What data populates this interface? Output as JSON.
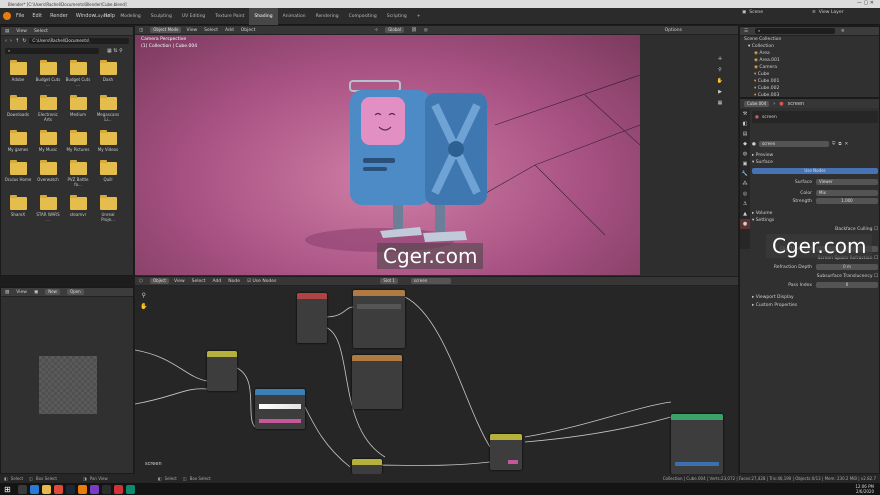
{
  "titlebar": {
    "title": "Blender* [C:\\Users\\Rachel\\Documents\\Blender\\Cube.blend]"
  },
  "menu": [
    "File",
    "Edit",
    "Render",
    "Window",
    "Help"
  ],
  "workspaces": [
    "Layout",
    "Modeling",
    "Sculpting",
    "UV Editing",
    "Texture Paint",
    "Shading",
    "Animation",
    "Rendering",
    "Compositing",
    "Scripting"
  ],
  "active_workspace": "Shading",
  "scene": {
    "label": "Scene",
    "view_layer": "View Layer"
  },
  "file_browser": {
    "header": [
      "View",
      "Select"
    ],
    "path": "C:\\Users\\Rachel\\Documents\\",
    "folders": [
      "Adobe",
      "Budget Cuts ...",
      "Budget Cuts ...",
      "Dash",
      "Downloads",
      "Electronic Arts",
      "Medium",
      "Megascans Li...",
      "My games",
      "My Music",
      "My Pictures",
      "My Videos",
      "Oculus Home",
      "Overwatch",
      "PVZ Battle fo...",
      "Quill",
      "ShareX",
      "STAR WARS ...",
      "steamvr",
      "Unreal Proje..."
    ]
  },
  "viewport": {
    "mode": "Object Mode",
    "menus": [
      "View",
      "Select",
      "Add",
      "Object"
    ],
    "transform": "Global",
    "options": "Options",
    "camera": "Camera Perspective",
    "collection": "(1) Collection | Cube.004"
  },
  "outliner": {
    "root": "Scene Collection",
    "items": [
      "Collection",
      "Area",
      "Area.001",
      "Camera",
      "Cube",
      "Cube.001",
      "Cube.002",
      "Cube.003",
      "Cube.004"
    ]
  },
  "properties": {
    "object": "Cube.004",
    "material_slot": "screen",
    "material": "screen",
    "sections": {
      "preview": "Preview",
      "surface": "Surface"
    },
    "use_nodes": "Use Nodes",
    "surface_label": "Surface",
    "surface_value": "Viewer",
    "color_label": "Color",
    "color_value": "Mix",
    "strength_label": "Strength",
    "strength_value": "1.000",
    "volume": "Volume",
    "settings": "Settings",
    "backface": "Backface Culling",
    "clip_threshold_label": "Clip Threshold",
    "ssr": "Screen Space Refraction",
    "refraction_label": "Refraction Depth",
    "refraction_value": "0 m",
    "sss": "Subsurface Translucency",
    "pass_label": "Pass Index",
    "pass_value": "0",
    "viewport_display": "Viewport Display",
    "custom_props": "Custom Properties"
  },
  "image_editor": {
    "menus": [
      "View"
    ],
    "new": "New",
    "open": "Open"
  },
  "node_editor": {
    "object": "Object",
    "menus": [
      "View",
      "Select",
      "Add",
      "Node"
    ],
    "use_nodes": "Use Nodes",
    "slot": "Slot 1",
    "material": "screen",
    "footer": "screen"
  },
  "status": {
    "left": [
      "Select",
      "Box Select",
      "Pan View",
      "Select",
      "Box Select"
    ],
    "right": "Collection | Cube.004 | Verts:23,072 | Faces:27,428 | Tris:46,190 | Objects:0/13 | Mem: 230.2 MiB | v2.82.7"
  },
  "taskbar": {
    "time": "12:06 PM",
    "date": "2/6/2020"
  },
  "watermark": "Cger.com"
}
